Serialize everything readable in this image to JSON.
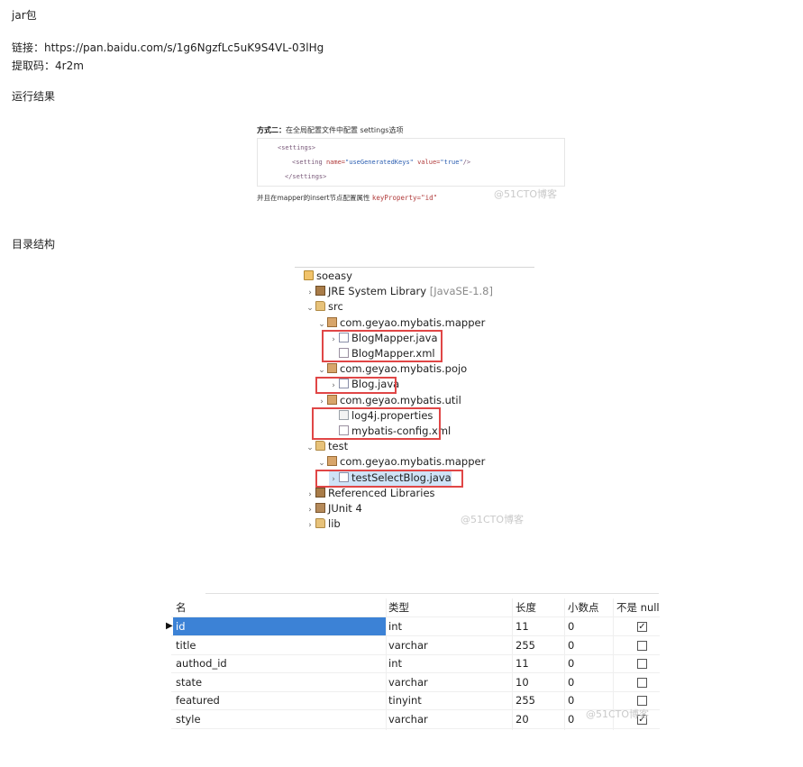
{
  "intro": {
    "jar_title": "jar包",
    "link_line": "链接：https://pan.baidu.com/s/1g6NgzfLc5uK9S4VL-03lHg",
    "code_line": "提取码：4r2m",
    "run_result": "运行结果",
    "dir_structure": "目录结构"
  },
  "figure1": {
    "caption_bold": "方式二：",
    "caption_rest": "在全局配置文件中配置 settings选项",
    "code_open": "<settings>",
    "code_setting_pre": "<setting ",
    "code_attr_name": "name=",
    "code_name_val": "\"useGeneratedKeys\"",
    "code_attr_value": " value=",
    "code_value_val": "\"true\"",
    "code_setting_post": "/>",
    "code_close": "</settings>",
    "footer_text": "并且在mapper的insert节点配置属性 ",
    "footer_code": "keyProperty=\"id\"",
    "watermark": "@51CTO博客"
  },
  "tree": {
    "watermark": "@51CTO博客",
    "items": [
      {
        "label": "soeasy",
        "suffix": "",
        "icon": "project-icon",
        "chev": ""
      },
      {
        "label": "JRE System Library ",
        "suffix": "[JavaSE-1.8]",
        "icon": "library-icon",
        "chev": "›"
      },
      {
        "label": "src",
        "suffix": "",
        "icon": "source-folder-icon",
        "chev": "⌄"
      },
      {
        "label": "com.geyao.mybatis.mapper",
        "suffix": "",
        "icon": "package-icon",
        "chev": "⌄"
      },
      {
        "label": "BlogMapper.java",
        "suffix": "",
        "icon": "java-file-icon",
        "chev": "›"
      },
      {
        "label": "BlogMapper.xml",
        "suffix": "",
        "icon": "xml-file-icon",
        "chev": ""
      },
      {
        "label": "com.geyao.mybatis.pojo",
        "suffix": "",
        "icon": "package-icon",
        "chev": "⌄"
      },
      {
        "label": "Blog.java",
        "suffix": "",
        "icon": "java-file-icon",
        "chev": "›"
      },
      {
        "label": "com.geyao.mybatis.util",
        "suffix": "",
        "icon": "package-icon",
        "chev": "›"
      },
      {
        "label": "log4j.properties",
        "suffix": "",
        "icon": "properties-file-icon",
        "chev": ""
      },
      {
        "label": "mybatis-config.xml",
        "suffix": "",
        "icon": "xml-file-icon",
        "chev": ""
      },
      {
        "label": "test",
        "suffix": "",
        "icon": "source-folder-icon",
        "chev": "⌄"
      },
      {
        "label": "com.geyao.mybatis.mapper",
        "suffix": "",
        "icon": "package-icon",
        "chev": "⌄"
      },
      {
        "label": "testSelectBlog.java",
        "suffix": "",
        "icon": "java-file-icon",
        "chev": "›"
      },
      {
        "label": "Referenced Libraries",
        "suffix": "",
        "icon": "library-icon",
        "chev": "›"
      },
      {
        "label": "JUnit 4",
        "suffix": "",
        "icon": "junit-library-icon",
        "chev": "›"
      },
      {
        "label": "lib",
        "suffix": "",
        "icon": "folder-icon",
        "chev": "›"
      }
    ]
  },
  "table": {
    "headers": [
      "名",
      "类型",
      "长度",
      "小数点",
      "不是 null"
    ],
    "rows": [
      {
        "name": "id",
        "type": "int",
        "length": "11",
        "decimals": "0",
        "not_null": true
      },
      {
        "name": "title",
        "type": "varchar",
        "length": "255",
        "decimals": "0",
        "not_null": false
      },
      {
        "name": "authod_id",
        "type": "int",
        "length": "11",
        "decimals": "0",
        "not_null": false
      },
      {
        "name": "state",
        "type": "varchar",
        "length": "10",
        "decimals": "0",
        "not_null": false
      },
      {
        "name": "featured",
        "type": "tinyint",
        "length": "255",
        "decimals": "0",
        "not_null": false
      },
      {
        "name": "style",
        "type": "varchar",
        "length": "20",
        "decimals": "0",
        "not_null": true
      }
    ],
    "watermark": "@51CTO博客"
  }
}
